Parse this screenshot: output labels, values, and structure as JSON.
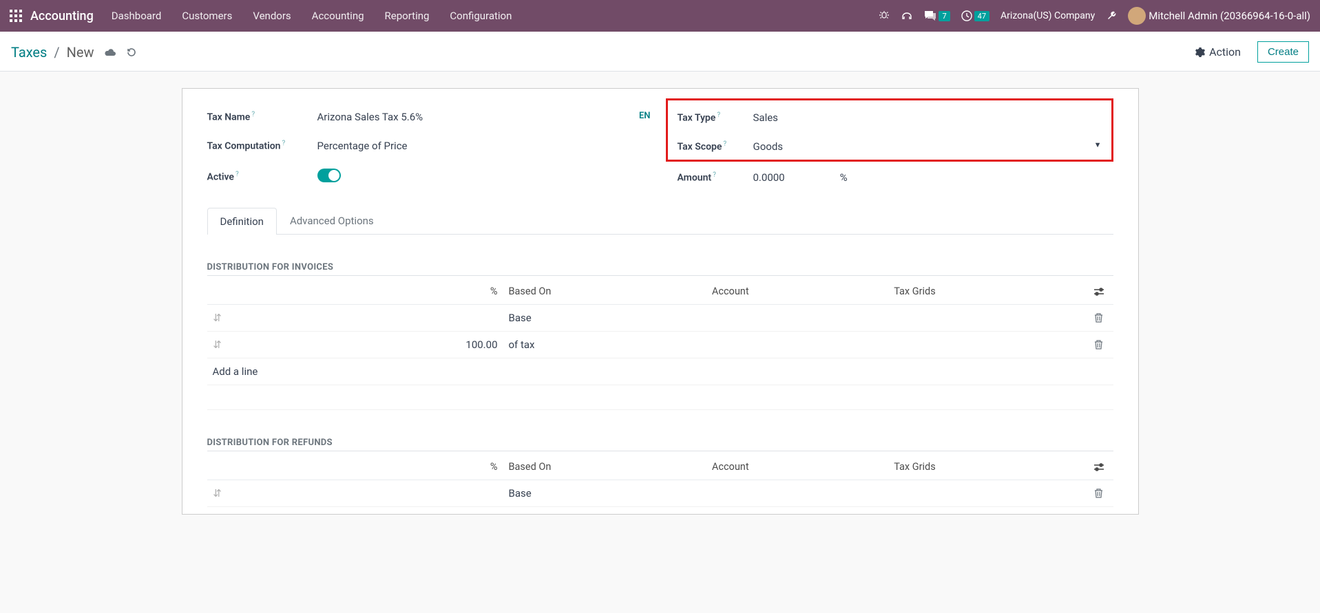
{
  "topbar": {
    "brand": "Accounting",
    "nav": [
      "Dashboard",
      "Customers",
      "Vendors",
      "Accounting",
      "Reporting",
      "Configuration"
    ],
    "messages_count": "7",
    "activities_count": "47",
    "company": "Arizona(US) Company",
    "user": "Mitchell Admin (20366964-16-0-all)"
  },
  "breadcrumb": {
    "parent": "Taxes",
    "current": "New"
  },
  "control_panel": {
    "action": "Action",
    "create": "Create"
  },
  "form": {
    "left": {
      "tax_name_label": "Tax Name",
      "tax_name_value": "Arizona Sales Tax 5.6%",
      "lang": "EN",
      "tax_computation_label": "Tax Computation",
      "tax_computation_value": "Percentage of Price",
      "active_label": "Active"
    },
    "right": {
      "tax_type_label": "Tax Type",
      "tax_type_value": "Sales",
      "tax_scope_label": "Tax Scope",
      "tax_scope_value": "Goods",
      "amount_label": "Amount",
      "amount_value": "0.0000",
      "amount_unit": "%"
    }
  },
  "tabs": {
    "definition": "Definition",
    "advanced": "Advanced Options"
  },
  "sections": {
    "invoices_title": "Distribution for Invoices",
    "refunds_title": "Distribution for Refunds",
    "headers": {
      "pct": "%",
      "based_on": "Based On",
      "account": "Account",
      "tax_grids": "Tax Grids"
    },
    "invoice_rows": [
      {
        "pct": "",
        "based_on": "Base"
      },
      {
        "pct": "100.00",
        "based_on": "of tax"
      }
    ],
    "refund_rows": [
      {
        "pct": "",
        "based_on": "Base"
      }
    ],
    "add_line": "Add a line"
  }
}
